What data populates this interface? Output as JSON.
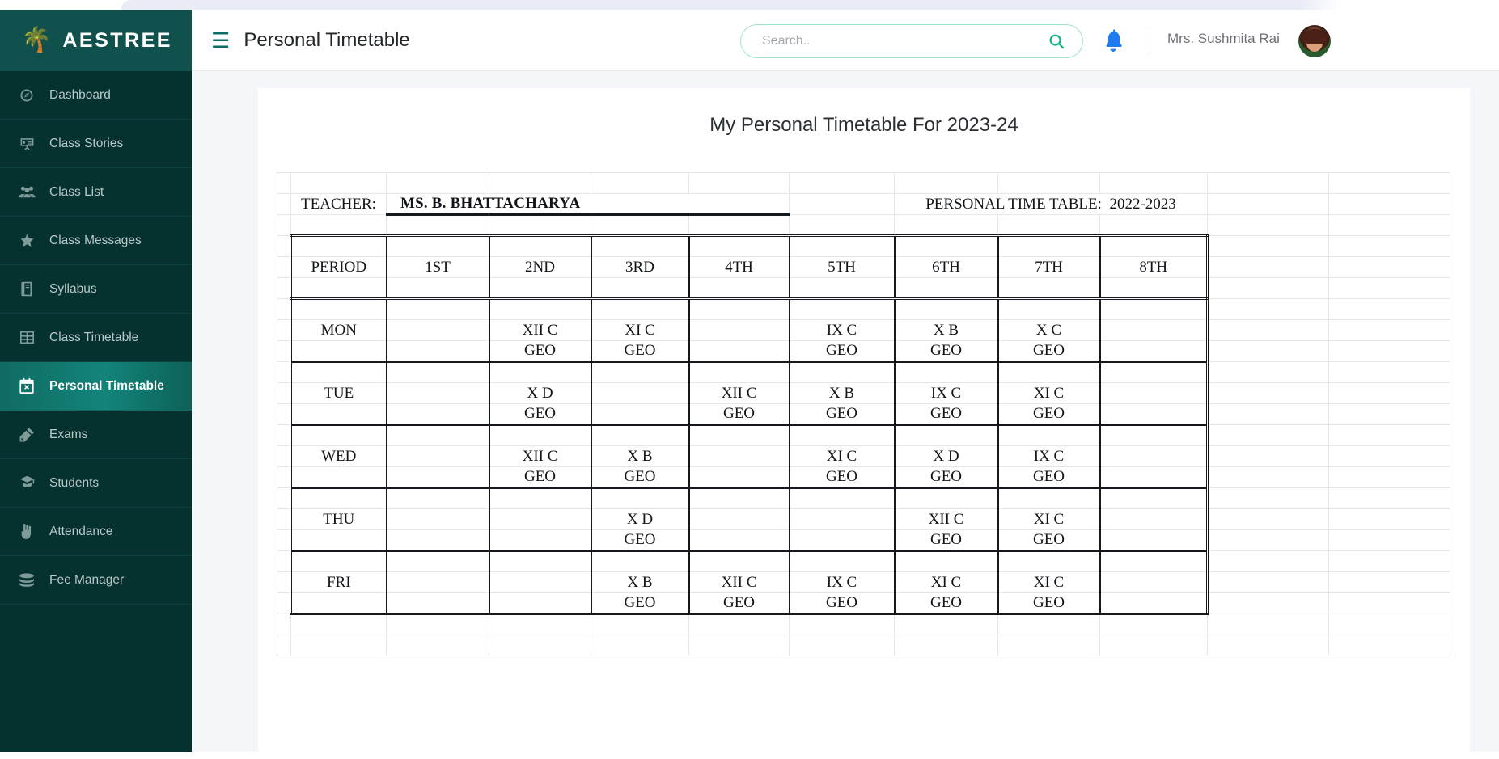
{
  "brand": {
    "name": "AESTREE",
    "logo_icon": "palm-tree-icon"
  },
  "sidebar": {
    "items": [
      {
        "label": "Dashboard",
        "icon": "speedometer-icon",
        "active": false
      },
      {
        "label": "Class Stories",
        "icon": "presentation-icon",
        "active": false
      },
      {
        "label": "Class List",
        "icon": "users-group-icon",
        "active": false
      },
      {
        "label": "Class Messages",
        "icon": "star-icon",
        "active": false
      },
      {
        "label": "Syllabus",
        "icon": "book-icon",
        "active": false
      },
      {
        "label": "Class Timetable",
        "icon": "table-grid-icon",
        "active": false
      },
      {
        "label": "Personal Timetable",
        "icon": "calendar-check-icon",
        "active": true
      },
      {
        "label": "Exams",
        "icon": "pencil-ruler-icon",
        "active": false
      },
      {
        "label": "Students",
        "icon": "graduate-icon",
        "active": false
      },
      {
        "label": "Attendance",
        "icon": "hand-raised-icon",
        "active": false
      },
      {
        "label": "Fee Manager",
        "icon": "coins-icon",
        "active": false
      }
    ]
  },
  "header": {
    "menu_icon": "hamburger-icon",
    "title": "Personal Timetable",
    "search": {
      "value": "",
      "placeholder": "Search..",
      "icon": "search-icon"
    },
    "notifications_icon": "bell-icon",
    "user_name": "Mrs. Sushmita Rai",
    "avatar_icon": "user-avatar"
  },
  "main": {
    "title": "My Personal Timetable For 2023-24"
  },
  "timetable": {
    "teacher_label": "TEACHER:",
    "teacher_name": "MS. B. BHATTACHARYA",
    "ptt_label": "PERSONAL TIME TABLE:",
    "ptt_year": "2022-2023",
    "period_header": "PERIOD",
    "periods": [
      "1ST",
      "2ND",
      "3RD",
      "4TH",
      "5TH",
      "6TH",
      "7TH",
      "8TH"
    ],
    "rows": [
      {
        "day": "MON",
        "cells": [
          {
            "cls": "",
            "sub": ""
          },
          {
            "cls": "XII C",
            "sub": "GEO"
          },
          {
            "cls": "XI C",
            "sub": "GEO"
          },
          {
            "cls": "",
            "sub": ""
          },
          {
            "cls": "IX C",
            "sub": "GEO"
          },
          {
            "cls": "X B",
            "sub": "GEO"
          },
          {
            "cls": "X C",
            "sub": "GEO"
          },
          {
            "cls": "",
            "sub": ""
          }
        ]
      },
      {
        "day": "TUE",
        "cells": [
          {
            "cls": "",
            "sub": ""
          },
          {
            "cls": "X D",
            "sub": "GEO"
          },
          {
            "cls": "",
            "sub": ""
          },
          {
            "cls": "XII C",
            "sub": "GEO"
          },
          {
            "cls": "X B",
            "sub": "GEO"
          },
          {
            "cls": "IX C",
            "sub": "GEO"
          },
          {
            "cls": "XI C",
            "sub": "GEO"
          },
          {
            "cls": "",
            "sub": ""
          }
        ]
      },
      {
        "day": "WED",
        "cells": [
          {
            "cls": "",
            "sub": ""
          },
          {
            "cls": "XII C",
            "sub": "GEO"
          },
          {
            "cls": "X B",
            "sub": "GEO"
          },
          {
            "cls": "",
            "sub": ""
          },
          {
            "cls": "XI C",
            "sub": "GEO"
          },
          {
            "cls": "X D",
            "sub": "GEO"
          },
          {
            "cls": "IX C",
            "sub": "GEO"
          },
          {
            "cls": "",
            "sub": ""
          }
        ]
      },
      {
        "day": "THU",
        "cells": [
          {
            "cls": "",
            "sub": ""
          },
          {
            "cls": "",
            "sub": ""
          },
          {
            "cls": "X D",
            "sub": "GEO"
          },
          {
            "cls": "",
            "sub": ""
          },
          {
            "cls": "",
            "sub": ""
          },
          {
            "cls": "XII C",
            "sub": "GEO"
          },
          {
            "cls": "XI C",
            "sub": "GEO"
          },
          {
            "cls": "",
            "sub": ""
          }
        ]
      },
      {
        "day": "FRI",
        "cells": [
          {
            "cls": "",
            "sub": ""
          },
          {
            "cls": "",
            "sub": ""
          },
          {
            "cls": "X B",
            "sub": "GEO"
          },
          {
            "cls": "XII C",
            "sub": "GEO"
          },
          {
            "cls": "IX C",
            "sub": "GEO"
          },
          {
            "cls": "XI C",
            "sub": "GEO"
          },
          {
            "cls": "XI C",
            "sub": "GEO"
          },
          {
            "cls": "",
            "sub": ""
          }
        ]
      }
    ]
  },
  "colors": {
    "sidebar_bg": "#05312f",
    "sidebar_brand_bg": "#10514d",
    "accent_teal": "#0f6b63",
    "active_gradient_start": "#0f6b63",
    "active_gradient_end": "#13847a",
    "search_border": "#9fe3c8",
    "search_icon": "#19b08a",
    "bell": "#1e7bf0",
    "content_bg": "#f4f6fa",
    "grid_line": "#e6e6e6",
    "grid_heavy": "#15181c"
  }
}
